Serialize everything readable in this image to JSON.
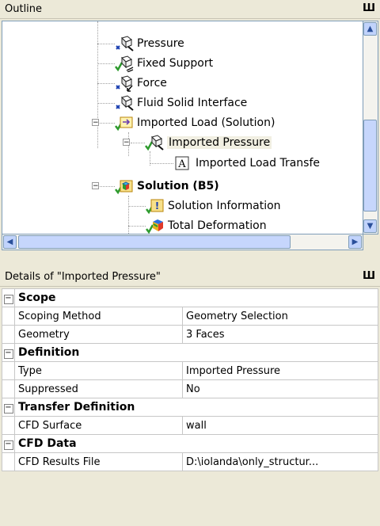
{
  "outline": {
    "title": "Outline",
    "pin": "Ш",
    "items": [
      {
        "label": "Pressure",
        "icon": "load-icon"
      },
      {
        "label": "Fixed Support",
        "icon": "support-icon"
      },
      {
        "label": "Force",
        "icon": "force-icon"
      },
      {
        "label": "Fluid Solid Interface",
        "icon": "fsi-icon"
      },
      {
        "label": "Imported Load (Solution)",
        "icon": "imported-load-folder-icon"
      },
      {
        "label": "Imported Pressure",
        "icon": "imported-pressure-icon"
      },
      {
        "label": "Imported Load Transfe",
        "icon": "text-a-icon"
      },
      {
        "label": "Solution (B5)",
        "icon": "solution-icon"
      },
      {
        "label": "Solution Information",
        "icon": "solution-information-icon"
      },
      {
        "label": "Total Deformation",
        "icon": "total-deformation-icon"
      }
    ]
  },
  "details": {
    "title": "Details of \"Imported Pressure\"",
    "pin": "Ш",
    "sections": [
      {
        "name": "Scope",
        "rows": [
          {
            "property": "Scoping Method",
            "value": "Geometry Selection"
          },
          {
            "property": "Geometry",
            "value": "3 Faces"
          }
        ]
      },
      {
        "name": "Definition",
        "rows": [
          {
            "property": "Type",
            "value": "Imported Pressure"
          },
          {
            "property": "Suppressed",
            "value": "No"
          }
        ]
      },
      {
        "name": "Transfer Definition",
        "rows": [
          {
            "property": "CFD Surface",
            "value": "wall"
          }
        ]
      },
      {
        "name": "CFD Data",
        "rows": [
          {
            "property": "CFD Results File",
            "value": "D:\\iolanda\\only_structur..."
          }
        ]
      }
    ]
  },
  "colors": {
    "accent": "#316ac5",
    "status_ok": "#2e9b2e",
    "status_missing": "#1a3fb0"
  }
}
